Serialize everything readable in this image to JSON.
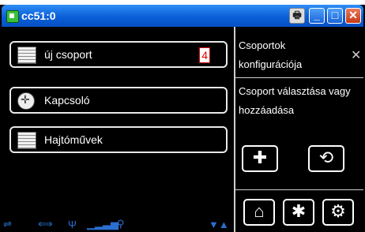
{
  "window": {
    "title": "cc51:0",
    "buttons": {
      "print": "🖶",
      "minimize": "_",
      "maximize": "□",
      "close": "✕"
    }
  },
  "groups": [
    {
      "label": "új csoport",
      "icon": "blinds-icon",
      "count": "4"
    },
    {
      "label": "Kapcsoló",
      "icon": "switch-icon"
    },
    {
      "label": "Hajtóművek",
      "icon": "blinds-icon"
    }
  ],
  "panel": {
    "title": "Csoportok konfigurációja",
    "description": "Csoport választása vagy hozzáadása",
    "add_glyph": "✚",
    "back_glyph": "⟲",
    "home_glyph": "⌂",
    "fan_glyph": "✱",
    "settings_glyph": "⚙",
    "close_glyph": "✕"
  },
  "status": {
    "icons": [
      "network-icon",
      "link-icon",
      "antenna-icon",
      "signal-icon",
      "devices-icon",
      "scroll-arrows-icon"
    ]
  }
}
